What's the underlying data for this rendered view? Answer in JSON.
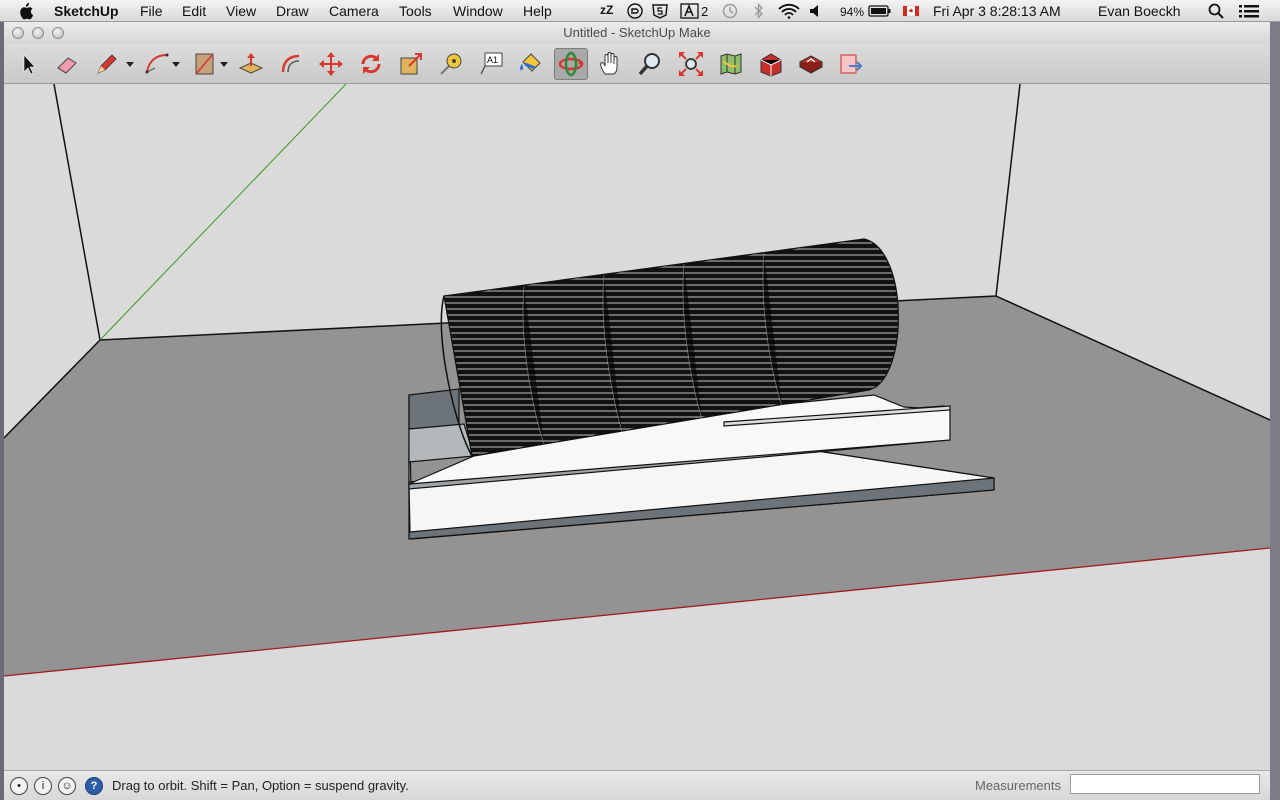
{
  "menubar": {
    "app_name": "SketchUp",
    "menus": [
      "File",
      "Edit",
      "View",
      "Draw",
      "Camera",
      "Tools",
      "Window",
      "Help"
    ],
    "tray": {
      "notifications_count": "2",
      "battery": "94%",
      "clock": "Fri Apr 3  8:28:13 AM",
      "user": "Evan Boeckh"
    }
  },
  "window": {
    "title": "Untitled - SketchUp Make"
  },
  "toolbar": {
    "tools": [
      {
        "name": "select-tool",
        "icon": "arrow-icon"
      },
      {
        "name": "eraser-tool",
        "icon": "eraser-icon"
      },
      {
        "name": "line-tool",
        "icon": "pencil-icon"
      },
      {
        "name": "arc-tool",
        "icon": "arc-icon"
      },
      {
        "name": "shape-tool",
        "icon": "rectangle-icon"
      },
      {
        "name": "push-pull-tool",
        "icon": "push-pull-icon"
      },
      {
        "name": "offset-tool",
        "icon": "offset-icon"
      },
      {
        "name": "move-tool",
        "icon": "move-icon"
      },
      {
        "name": "rotate-tool",
        "icon": "rotate-icon"
      },
      {
        "name": "scale-tool",
        "icon": "scale-icon"
      },
      {
        "name": "tape-measure-tool",
        "icon": "tape-measure-icon"
      },
      {
        "name": "text-tool",
        "icon": "text-icon"
      },
      {
        "name": "paint-bucket-tool",
        "icon": "paint-bucket-icon"
      },
      {
        "name": "orbit-tool",
        "icon": "orbit-icon"
      },
      {
        "name": "pan-tool",
        "icon": "hand-icon"
      },
      {
        "name": "zoom-tool",
        "icon": "magnifier-icon"
      },
      {
        "name": "zoom-extents-tool",
        "icon": "zoom-extents-icon"
      },
      {
        "name": "add-location-tool",
        "icon": "map-icon"
      },
      {
        "name": "3d-warehouse-tool",
        "icon": "warehouse-icon"
      },
      {
        "name": "share-model-tool",
        "icon": "share-model-icon"
      },
      {
        "name": "send-to-layout-tool",
        "icon": "layout-icon"
      }
    ],
    "text_tool_label": "A1"
  },
  "status": {
    "hint": "Drag to orbit. Shift = Pan, Option = suspend gravity.",
    "measurements_label": "Measurements",
    "measurements_value": ""
  },
  "colors": {
    "red_axis": "#a01c1c",
    "green_axis": "#3a9a1e",
    "ground": "#939393",
    "sky": "#dadada"
  }
}
